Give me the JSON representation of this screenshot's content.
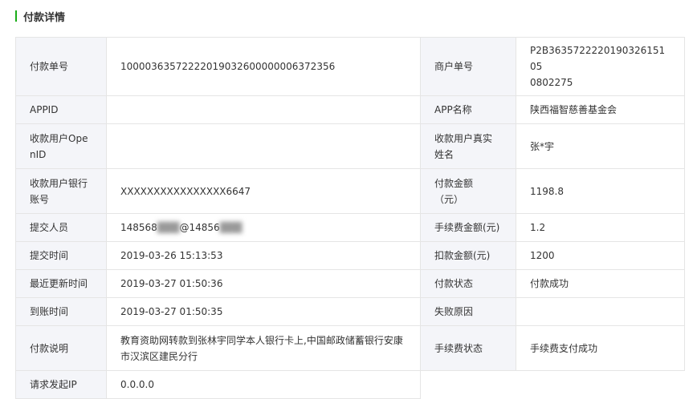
{
  "section": {
    "title": "付款详情",
    "accent_color": "#1aad19"
  },
  "rows": [
    {
      "l1": "付款单号",
      "v1": "10000363572222019032600000006372356",
      "l2": "商户单号",
      "v2": "P2B363572222019032615105\n0802275"
    },
    {
      "l1": "APPID",
      "v1": "",
      "l2": "APP名称",
      "v2": "陕西福智慈善基金会"
    },
    {
      "l1": "收款用户Ope\nnID",
      "v1": "",
      "l2": "收款用户真实\n姓名",
      "v2": "张*宇"
    },
    {
      "l1": "收款用户银行\n账号",
      "v1": "XXXXXXXXXXXXXXXX6647",
      "l2": "付款金额\n（元）",
      "v2": "1198.8"
    },
    {
      "l1": "提交人员",
      "v1_a": "148568",
      "v1_b": "@14856",
      "l2": "手续费金额(元)",
      "v2": "1.2"
    },
    {
      "l1": "提交时间",
      "v1": "2019-03-26 15:13:53",
      "l2": "扣款金额(元)",
      "v2": "1200"
    },
    {
      "l1": "最近更新时间",
      "v1": "2019-03-27 01:50:36",
      "l2": "付款状态",
      "v2": "付款成功"
    },
    {
      "l1": "到账时间",
      "v1": "2019-03-27 01:50:35",
      "l2": "失败原因",
      "v2": ""
    },
    {
      "l1": "付款说明",
      "v1": "教育资助网转款到张林宇同学本人银行卡上,中国邮政储蓄银行安康市汉滨区建民分行",
      "l2": "手续费状态",
      "v2": "手续费支付成功"
    },
    {
      "l1": "请求发起IP",
      "v1": "0.0.0.0"
    }
  ]
}
